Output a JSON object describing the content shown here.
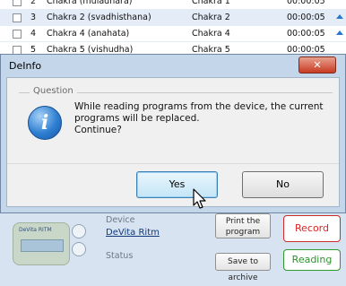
{
  "list": {
    "rows": [
      {
        "num": "2",
        "name": "Chakra (muladhara)",
        "group": "Chakra 1",
        "duration": "00:00:05"
      },
      {
        "num": "3",
        "name": "Chakra 2 (svadhisthana)",
        "group": "Chakra 2",
        "duration": "00:00:05"
      },
      {
        "num": "4",
        "name": "Chakra 4 (anahata)",
        "group": "Chakra 4",
        "duration": "00:00:05"
      },
      {
        "num": "5",
        "name": "Chakra 5 (vishudha)",
        "group": "Chakra 5",
        "duration": "00:00:05"
      }
    ]
  },
  "dialog": {
    "title": "DeInfo",
    "close_glyph": "✕",
    "group_label": "Question",
    "icon": "info-icon",
    "message_lines": [
      "While reading programs from the device, the current",
      "programs will be replaced.",
      "Continue?"
    ],
    "yes_label": "Yes",
    "no_label": "No"
  },
  "panel": {
    "device_label": "Device",
    "device_value": "DeVita Ritm",
    "device_screen": "DeVita RITM",
    "status_label": "Status",
    "print_label_line1": "Print the",
    "print_label_line2": "program",
    "record_label": "Record",
    "save_label": "Save to archive",
    "reading_label": "Reading"
  },
  "colors": {
    "accent": "#2b78c9",
    "record": "#d22222",
    "reading": "#2a942a",
    "close": "#c73a22"
  }
}
